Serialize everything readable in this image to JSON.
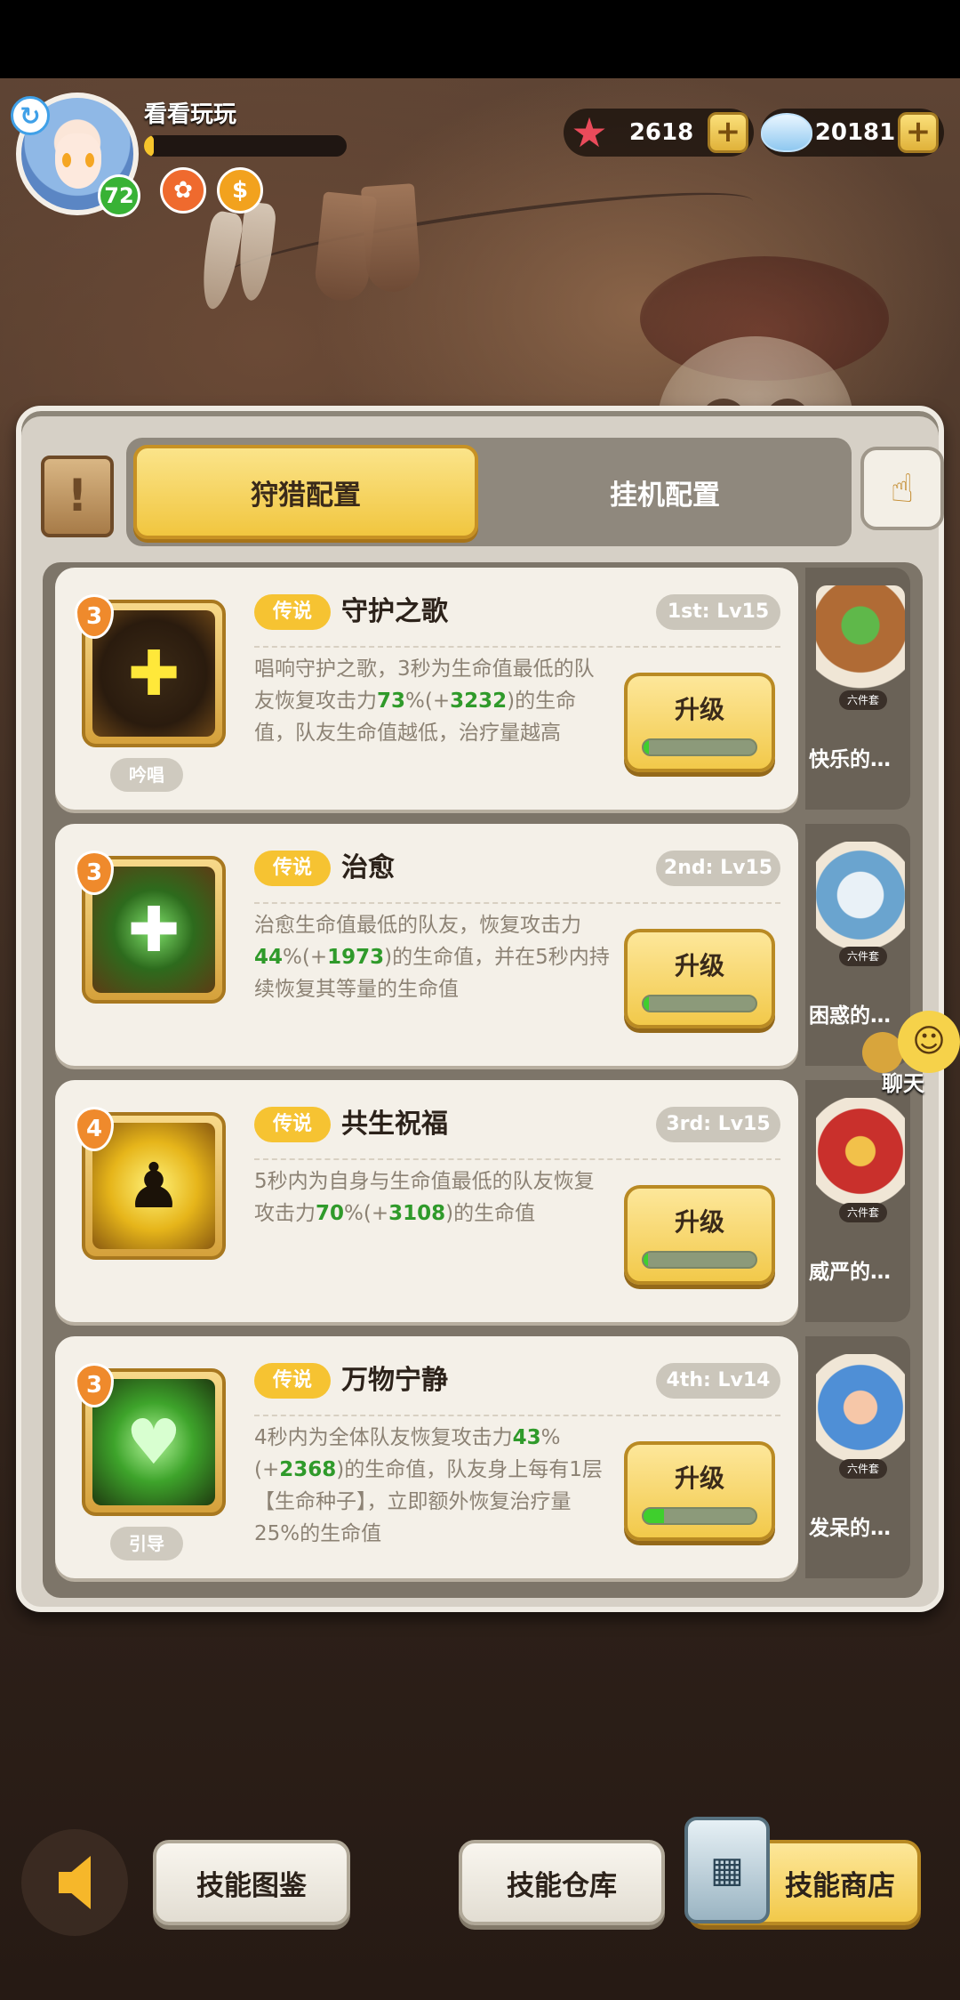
{
  "player": {
    "name": "看看玩玩",
    "level": "72",
    "exp_fraction": 0.05
  },
  "currencies": [
    {
      "icon": "starfish-icon",
      "value": "2618"
    },
    {
      "icon": "shell-icon",
      "value": "20181"
    }
  ],
  "tabs": {
    "active": "狩猎配置",
    "inactive": "挂机配置"
  },
  "skills": [
    {
      "rank": "3",
      "rarity": "传说",
      "name": "守护之歌",
      "slot": "1st: Lv15",
      "type": "吟唱",
      "desc_parts": [
        "唱响守护之歌，3秒为生命值最低的队友恢复攻击力",
        "73",
        "%(+",
        "3232",
        ")的生命值，队友生命值越低，治疗量越高"
      ],
      "upgrade_label": "升级",
      "upgrade_progress": 0.05,
      "pet_name": "快乐的土…",
      "pet_tag": "六件套"
    },
    {
      "rank": "3",
      "rarity": "传说",
      "name": "治愈",
      "slot": "2nd: Lv15",
      "type": "",
      "desc_parts": [
        "治愈生命值最低的队友，恢复攻击力",
        "44",
        "%(+",
        "1973",
        ")的生命值，并在5秒内持续恢复其等量的生命值"
      ],
      "upgrade_label": "升级",
      "upgrade_progress": 0.05,
      "pet_name": "困惑的骨…",
      "pet_tag": "六件套"
    },
    {
      "rank": "4",
      "rarity": "传说",
      "name": "共生祝福",
      "slot": "3rd: Lv15",
      "type": "",
      "desc_parts": [
        "5秒内为自身与生命值最低的队友恢复攻击力",
        "70",
        "%(+",
        "3108",
        ")的生命值"
      ],
      "upgrade_label": "升级",
      "upgrade_progress": 0.04,
      "pet_name": "威严的女…",
      "pet_tag": "六件套"
    },
    {
      "rank": "3",
      "rarity": "传说",
      "name": "万物宁静",
      "slot": "4th: Lv14",
      "type": "引导",
      "desc_parts": [
        "4秒内为全体队友恢复攻击力",
        "43",
        "%(+",
        "2368",
        ")的生命值，队友身上每有1层【生命种子】，立即额外恢复治疗量25%的生命值"
      ],
      "upgrade_label": "升级",
      "upgrade_progress": 0.18,
      "pet_name": "发呆的蓬…",
      "pet_tag": "六件套"
    }
  ],
  "chat": {
    "label": "聊天"
  },
  "bottom": {
    "codex": "技能图鉴",
    "storage": "技能仓库",
    "shop": "技能商店"
  },
  "colors": {
    "accent": "#f2c94a",
    "highlight_green": "#2f9a2a",
    "rarity_legend": "#f6c332"
  }
}
